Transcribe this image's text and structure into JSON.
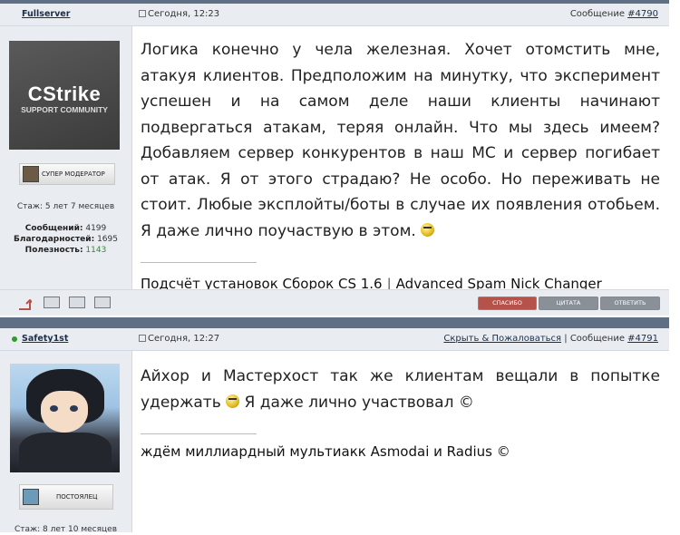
{
  "posts": [
    {
      "username": "Fullserver",
      "date": "Сегодня, 12:23",
      "message_label": "Сообщение",
      "message_number": "#4790",
      "avatar": {
        "title": "CStrike",
        "subtitle": "SUPPORT COMMUNITY"
      },
      "rank": "СУПЕР МОДЕРАТОР",
      "stats": {
        "tenure": "Стаж: 5 лет 7 месяцев",
        "messages_label": "Сообщений:",
        "messages": "4199",
        "thanks_label": "Благодарностей:",
        "thanks": "1695",
        "usefulness_label": "Полезность:",
        "usefulness": "1143"
      },
      "text": "Логика конечно у чела железная. Хочет отомстить мне, атакуя клиентов. Предположим на минутку, что эксперимент успешен и на самом деле наши клиенты начинают подвергаться атакам, теряя онлайн. Что мы здесь имеем? Добавляем сервер конкурентов в наш МС и сервер погибает от атак. Я от этого страдаю? Не особо. Но переживать не стоит. Любые эксплойты/боты в случае их появления отобьем. Я даже лично поучаствую в этом.",
      "signature": {
        "link1": "Подсчёт установок Сборок CS 1.6",
        "sep": "|",
        "link2": "Advanced Spam Nick Changer"
      },
      "buttons": {
        "thanks": "СПАСИБО",
        "quote": "ЦИТАТА",
        "reply": "ОТВЕТИТЬ"
      }
    },
    {
      "username": "Safety1st",
      "date": "Сегодня, 12:27",
      "report_link": "Скрыть & Пожаловаться",
      "sep": "|",
      "message_label": "Сообщение",
      "message_number": "#4791",
      "rank": "ПОСТОЯЛЕЦ",
      "stats": {
        "tenure": "Стаж: 8 лет 10 месяцев"
      },
      "text_before": "Айхор и Мастерхост так же клиентам вещали в попытке удержать",
      "text_after": "Я даже лично участвовал ©",
      "signature": "ждём миллиардный мультиакк Asmodai и Radius ©"
    }
  ],
  "colors": {
    "header_bg": "#e9edf2",
    "top_bar": "#5e6f86",
    "online_dot": "#2e9b2e",
    "thanks_button": "#b5534b",
    "usefulness": "#2e8b2e"
  },
  "icons": [
    "post-icon",
    "smile-icon",
    "reply-arrow-icon",
    "report-icon",
    "quote-icon",
    "mail-icon"
  ]
}
